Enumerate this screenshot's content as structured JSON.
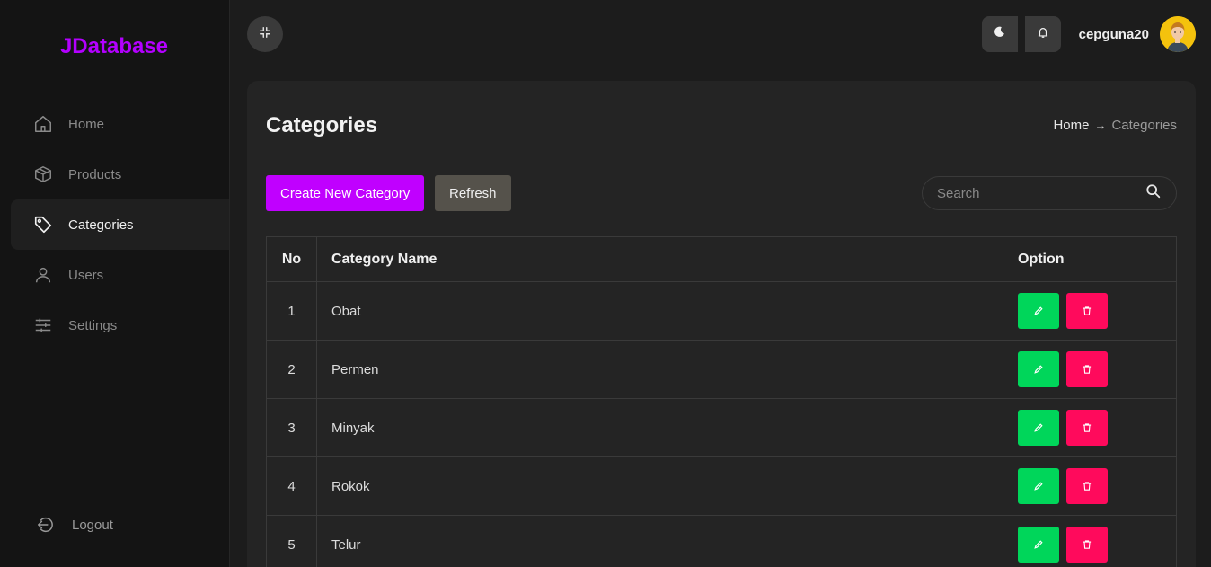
{
  "brand": "JDatabase",
  "nav": {
    "items": [
      {
        "label": "Home"
      },
      {
        "label": "Products"
      },
      {
        "label": "Categories"
      },
      {
        "label": "Users"
      },
      {
        "label": "Settings"
      }
    ],
    "logout": "Logout"
  },
  "header": {
    "username": "cepguna20"
  },
  "page": {
    "title": "Categories",
    "breadcrumb": {
      "home": "Home",
      "separator": "→",
      "current": "Categories"
    }
  },
  "toolbar": {
    "create_label": "Create New Category",
    "refresh_label": "Refresh",
    "search_placeholder": "Search"
  },
  "table": {
    "headers": {
      "no": "No",
      "name": "Category Name",
      "option": "Option"
    },
    "rows": [
      {
        "no": "1",
        "name": "Obat"
      },
      {
        "no": "2",
        "name": "Permen"
      },
      {
        "no": "3",
        "name": "Minyak"
      },
      {
        "no": "4",
        "name": "Rokok"
      },
      {
        "no": "5",
        "name": "Telur"
      }
    ]
  },
  "colors": {
    "brand": "#b300ff",
    "create_button": "#c000ff",
    "edit_button": "#00d65a",
    "delete_button": "#ff0a5c"
  }
}
